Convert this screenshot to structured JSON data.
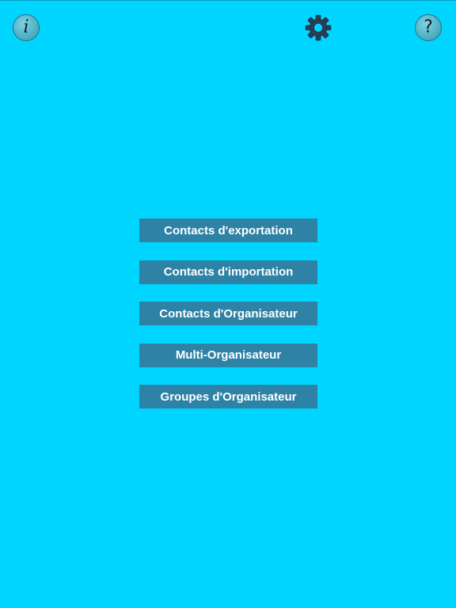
{
  "header": {
    "info_icon": "info-icon",
    "info_glyph": "i",
    "settings_icon": "gear-icon",
    "help_icon": "question-mark-icon",
    "help_glyph": "?"
  },
  "menu": {
    "items": [
      {
        "label": "Contacts d'exportation"
      },
      {
        "label": "Contacts d'importation"
      },
      {
        "label": "Contacts d'Organisateur"
      },
      {
        "label": "Multi-Organisateur"
      },
      {
        "label": "Groupes d'Organisateur"
      }
    ]
  },
  "colors": {
    "background": "#00d5ff",
    "button": "#2e82a5",
    "button_text": "#ffffff"
  }
}
